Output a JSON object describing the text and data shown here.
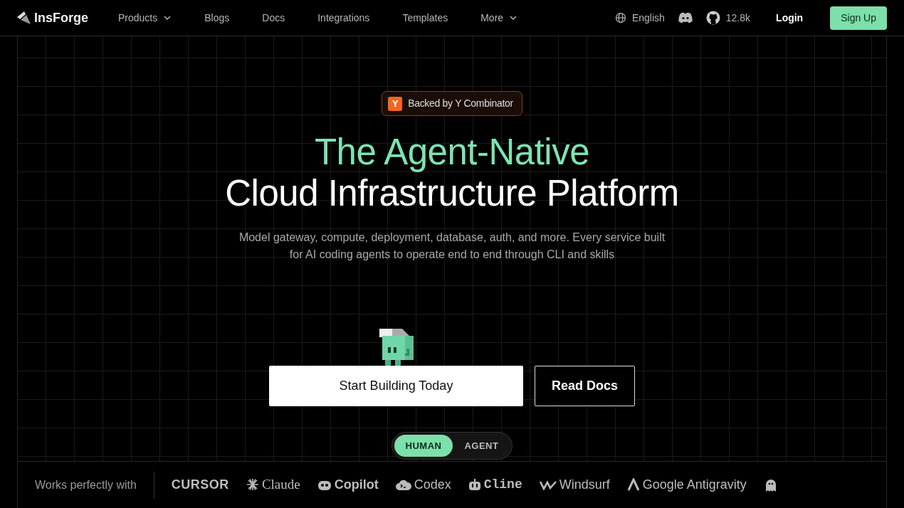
{
  "navbar": {
    "logo": "InsForge",
    "links": [
      {
        "label": "Products",
        "dropdown": true
      },
      {
        "label": "Blogs",
        "dropdown": false
      },
      {
        "label": "Docs",
        "dropdown": false
      },
      {
        "label": "Integrations",
        "dropdown": false
      },
      {
        "label": "Templates",
        "dropdown": false
      },
      {
        "label": "More",
        "dropdown": true
      }
    ],
    "language": "English",
    "github_stars": "12.8k",
    "login": "Login",
    "signup": "Sign Up"
  },
  "badge": {
    "icon": "Y",
    "text": "Backed by Y Combinator"
  },
  "headline": {
    "line_1": "The Agent-Native",
    "line_2": "Cloud Infrastructure Platform"
  },
  "subtitle": "Model gateway, compute, deployment, database, auth, and more. Every service built for AI coding agents to operate end to end through CLI and skills",
  "buttons": [
    {
      "label": "Start Building Today",
      "kind": "primary"
    },
    {
      "label": "Read Docs",
      "kind": "outline"
    }
  ],
  "mode_toggle": [
    {
      "label": "HUMAN",
      "selected": true
    },
    {
      "label": "AGENT",
      "selected": false
    }
  ],
  "integrations": {
    "label": "Works perfectly with",
    "items": [
      {
        "kind": "cursor",
        "name": "CURSOR"
      },
      {
        "kind": "claude",
        "name": "Claude"
      },
      {
        "kind": "copilot",
        "name": "Copilot"
      },
      {
        "kind": "codex",
        "name": "Codex"
      },
      {
        "kind": "cline",
        "name": "Cline"
      },
      {
        "kind": "windsurf",
        "name": "Windsurf"
      },
      {
        "kind": "antigravity",
        "name": "Google Antigravity"
      },
      {
        "kind": "ghost"
      }
    ]
  }
}
